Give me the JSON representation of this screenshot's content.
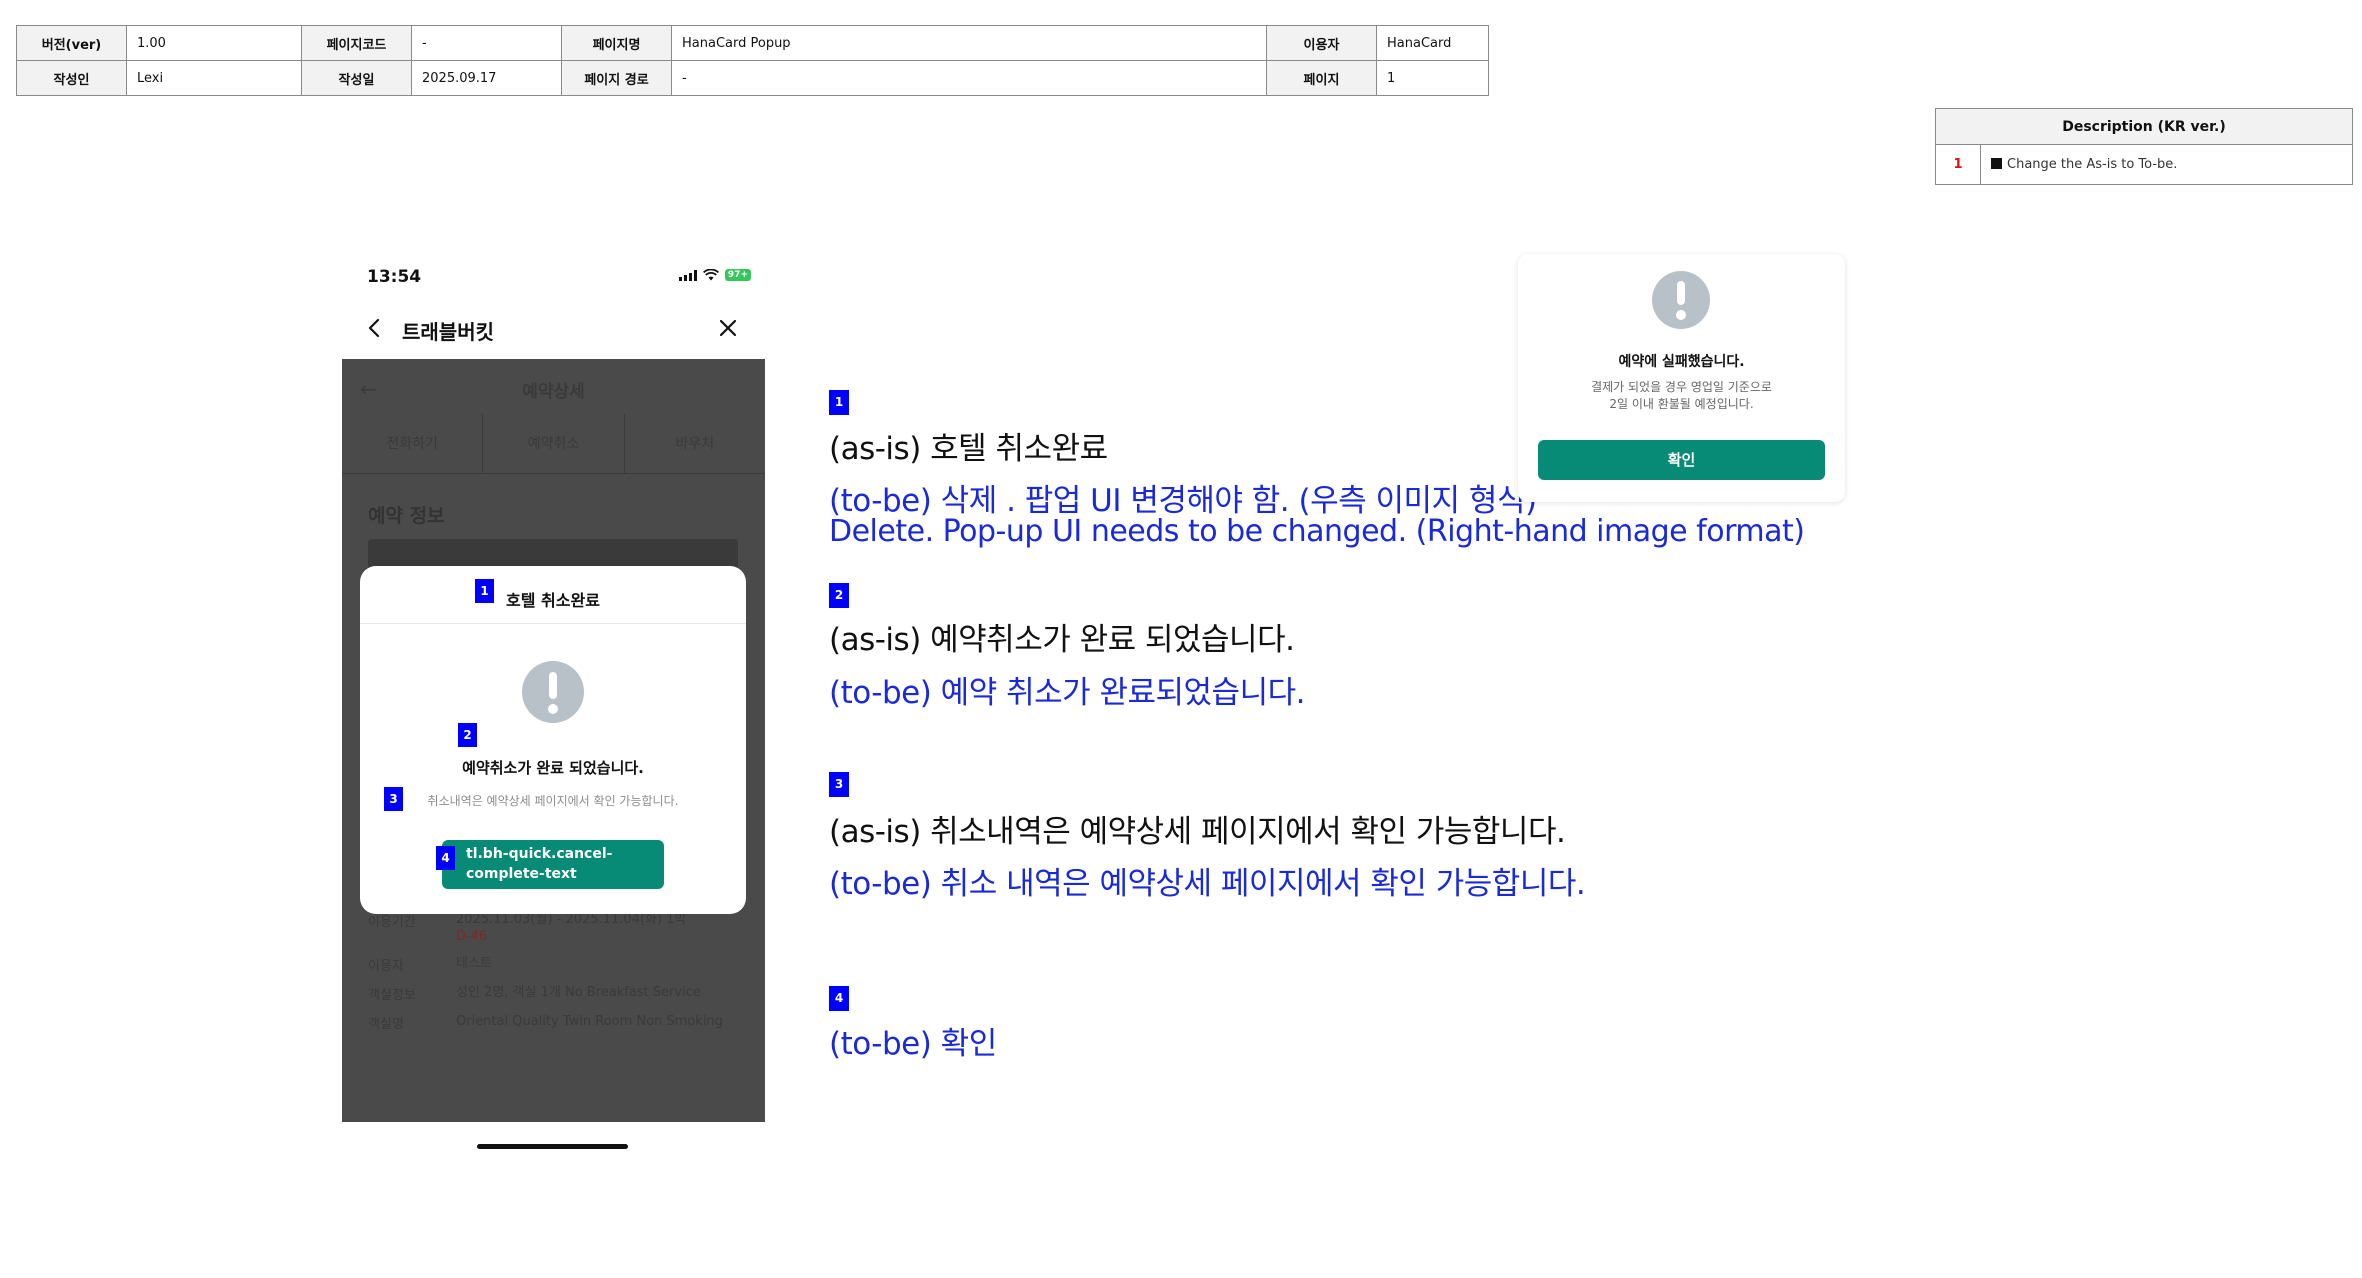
{
  "info": {
    "version_label": "버전(ver)",
    "version_value": "1.00",
    "page_code_label": "페이지코드",
    "page_code_value": "-",
    "page_name_label": "페이지명",
    "page_name_value": "HanaCard Popup",
    "user_label": "이용자",
    "user_value": "HanaCard",
    "author_label": "작성인",
    "author_value": "Lexi",
    "date_label": "작성일",
    "date_value": "2025.09.17",
    "path_label": "페이지 경로",
    "path_value": "-",
    "page_label": "페이지",
    "page_value": "1"
  },
  "description": {
    "header": "Description (KR ver.)",
    "rows": [
      {
        "num": "1",
        "text": "Change the As-is to To-be."
      }
    ]
  },
  "phone": {
    "time": "13:54",
    "battery": "97+",
    "app_title": "트래블버킷",
    "webview": {
      "back": "←",
      "title": "예약상세",
      "tabs": [
        "전화하기",
        "예약취소",
        "바우처"
      ],
      "section": "예약 정보",
      "rows": [
        {
          "label": "이용기간",
          "value": "2025.11.03(월) - 2025.11.04(화) 1박",
          "extra": "D-46"
        },
        {
          "label": "이용자",
          "value": "테스트"
        },
        {
          "label": "객실정보",
          "value": "성인 2명, 객실 1개 No Breakfast Service"
        },
        {
          "label": "객실명",
          "value": "Oriental Quality Twin Room Non Smoking"
        }
      ]
    },
    "popup": {
      "title": "호텔 취소완료",
      "message": "예약취소가 완료 되었습니다.",
      "sub": "취소내역은 예약상세 페이지에서 확인 가능합니다.",
      "button": "tl.bh-quick.cancel-complete-text"
    },
    "badges": [
      "1",
      "2",
      "3",
      "4"
    ]
  },
  "annotations": [
    {
      "num": "1",
      "as_is": "(as-is) 호텔 취소완료",
      "to_be": "(to-be) 삭제 . 팝업 UI 변경해야 함. (우측 이미지 형식)",
      "to_be_en": "Delete. Pop-up UI needs to be changed. (Right-hand image format)"
    },
    {
      "num": "2",
      "as_is": "(as-is) 예약취소가 완료 되었습니다.",
      "to_be": "(to-be) 예약 취소가 완료되었습니다."
    },
    {
      "num": "3",
      "as_is": "(as-is) 취소내역은 예약상세 페이지에서 확인 가능합니다.",
      "to_be": "(to-be) 취소 내역은 예약상세 페이지에서 확인 가능합니다."
    },
    {
      "num": "4",
      "to_be": "(to-be) 확인"
    }
  ],
  "reference_popup": {
    "title": "예약에 실패했습니다.",
    "body_line1": "결제가 되었을 경우 영업일 기준으로",
    "body_line2": "2일 이내 환불될 예정입니다.",
    "button": "확인"
  },
  "colors": {
    "accent": "#078a76",
    "annotation_blue": "#1a2ad8",
    "badge_blue": "#0000ff",
    "alert_gray": "#b8c1c7"
  }
}
